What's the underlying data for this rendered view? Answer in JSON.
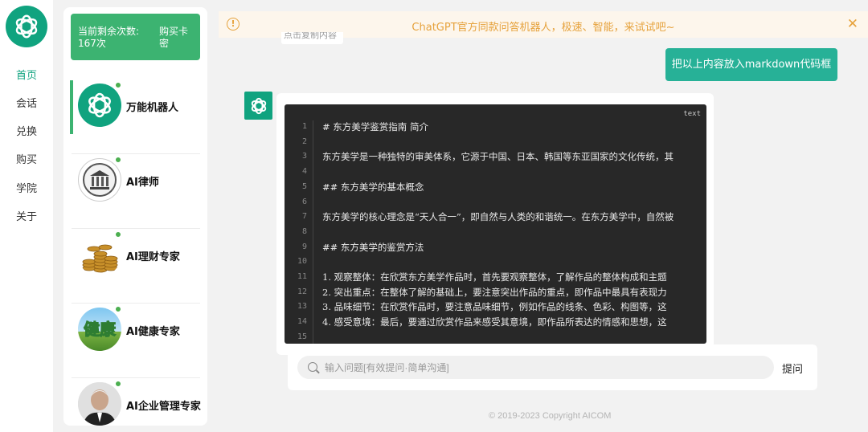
{
  "nav": {
    "items": [
      {
        "label": "首页",
        "active": true
      },
      {
        "label": "会话",
        "active": false
      },
      {
        "label": "兑换",
        "active": false
      },
      {
        "label": "购买",
        "active": false
      },
      {
        "label": "学院",
        "active": false
      },
      {
        "label": "关于",
        "active": false
      }
    ]
  },
  "quota": {
    "label": "当前剩余次数:",
    "count": "167次",
    "buy_label_1": "购买卡",
    "buy_label_2": "密"
  },
  "bots": [
    {
      "name": "万能机器人",
      "icon": "openai-logo-icon",
      "active": true
    },
    {
      "name": "AI律师",
      "icon": "courthouse-icon",
      "active": false
    },
    {
      "name": "AI理财专家",
      "icon": "gold-coins-icon",
      "active": false
    },
    {
      "name": "AI健康专家",
      "icon": "health-badge-icon",
      "active": false
    },
    {
      "name": "AI企业管理专家",
      "icon": "portrait-avatar",
      "active": false
    }
  ],
  "notice": {
    "text": "ChatGPT官方同款问答机器人，极速、智能，来试试吧~",
    "color": "#e6a23c"
  },
  "clipped_text": "点击复制内容",
  "chat": {
    "user_message": "把以上内容放入markdown代码框",
    "code_lang": "text",
    "code_lines": [
      {
        "n": "1",
        "t": "# 东方美学鉴赏指南 简介"
      },
      {
        "n": "2",
        "t": ""
      },
      {
        "n": "3",
        "t": "东方美学是一种独特的审美体系，它源于中国、日本、韩国等东亚国家的文化传统，其"
      },
      {
        "n": "4",
        "t": ""
      },
      {
        "n": "5",
        "t": "## 东方美学的基本概念"
      },
      {
        "n": "6",
        "t": ""
      },
      {
        "n": "7",
        "t": "东方美学的核心理念是“天人合一”，即自然与人类的和谐统一。在东方美学中，自然被"
      },
      {
        "n": "8",
        "t": ""
      },
      {
        "n": "9",
        "t": "## 东方美学的鉴赏方法"
      },
      {
        "n": "10",
        "t": ""
      },
      {
        "n": "11",
        "t": "1. 观察整体：在欣赏东方美学作品时，首先要观察整体，了解作品的整体构成和主题"
      },
      {
        "n": "12",
        "t": "2. 突出重点：在整体了解的基础上，要注意突出作品的重点，即作品中最具有表现力"
      },
      {
        "n": "13",
        "t": "3. 品味细节：在欣赏作品时，要注意品味细节，例如作品的线条、色彩、构图等，这"
      },
      {
        "n": "14",
        "t": "4. 感受意境：最后，要通过欣赏作品来感受其意境，即作品所表达的情感和思想，这"
      },
      {
        "n": "15",
        "t": ""
      }
    ]
  },
  "input": {
    "placeholder": "输入问题[有效提问·简单沟通]",
    "submit_label": "提问"
  },
  "footer": "© 2019-2023 Copyright AICOM",
  "colors": {
    "accent": "#10a37f",
    "quota_bg": "#3cb371",
    "user_bubble": "#27b197",
    "code_bg": "#282828"
  }
}
